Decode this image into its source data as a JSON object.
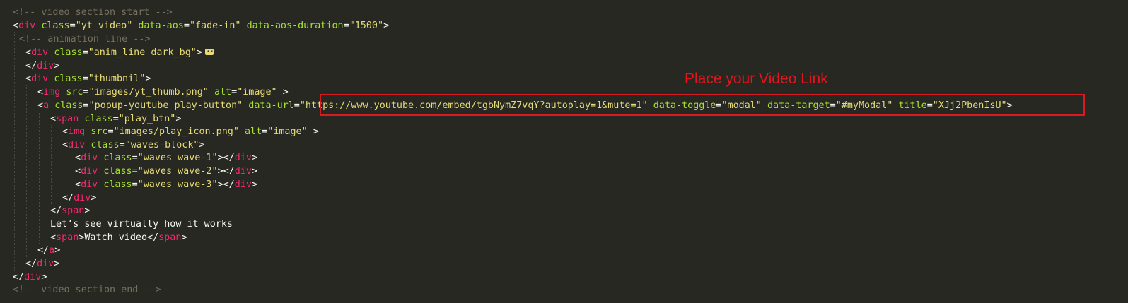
{
  "annotation": {
    "text": "Place your Video Link",
    "color": "#e7141d",
    "box_color": "#d81a23"
  },
  "theme": {
    "background": "#272822",
    "comment": "#75715e",
    "tag": "#f92672",
    "attribute": "#a6e22e",
    "string": "#e6db74",
    "text": "#f8f8f2"
  },
  "code": {
    "l1": {
      "c": "<!-- video section start -->"
    },
    "l2": {
      "o": "<",
      "t": "div",
      "a1": "class",
      "s1": "\"yt_video\"",
      "a2": "data-aos",
      "s2": "\"fade-in\"",
      "a3": "data-aos-duration",
      "s3": "\"1500\"",
      "e": ">"
    },
    "l3": {
      "c": "<!-- animation line -->"
    },
    "l4": {
      "o": "<",
      "t": "div",
      "a1": "class",
      "s1": "\"anim_line dark_bg\"",
      "e": ">"
    },
    "l5": {
      "o": "</",
      "t": "div",
      "e": ">"
    },
    "l6": {
      "o": "<",
      "t": "div",
      "a1": "class",
      "s1": "\"thumbnil\"",
      "e": ">"
    },
    "l7": {
      "o": "<",
      "t": "img",
      "a1": "src",
      "s1": "\"images/yt_thumb.png\"",
      "a2": "alt",
      "s2": "\"image\"",
      "e": " >"
    },
    "l8": {
      "o": "<",
      "t": "a",
      "a1": "class",
      "s1": "\"popup-youtube play-button\"",
      "a2": "data-url",
      "s2": "\"https://www.youtube.com/embed/tgbNymZ7vqY?autoplay=1&mute=1\"",
      "a3": "data-toggle",
      "s3": "\"modal\"",
      "a4": "data-target",
      "s4": "\"#myModal\"",
      "a5": "title",
      "s5": "\"XJj2PbenIsU\"",
      "e": ">"
    },
    "l9": {
      "o": "<",
      "t": "span",
      "a1": "class",
      "s1": "\"play_btn\"",
      "e": ">"
    },
    "l10": {
      "o": "<",
      "t": "img",
      "a1": "src",
      "s1": "\"images/play_icon.png\"",
      "a2": "alt",
      "s2": "\"image\"",
      "e": " >"
    },
    "l11": {
      "o": "<",
      "t": "div",
      "a1": "class",
      "s1": "\"waves-block\"",
      "e": ">"
    },
    "l12": {
      "o": "<",
      "t": "div",
      "a1": "class",
      "s1": "\"waves wave-1\"",
      "m": "></",
      "t2": "div",
      "e": ">"
    },
    "l13": {
      "o": "<",
      "t": "div",
      "a1": "class",
      "s1": "\"waves wave-2\"",
      "m": "></",
      "t2": "div",
      "e": ">"
    },
    "l14": {
      "o": "<",
      "t": "div",
      "a1": "class",
      "s1": "\"waves wave-3\"",
      "m": "></",
      "t2": "div",
      "e": ">"
    },
    "l15": {
      "o": "</",
      "t": "div",
      "e": ">"
    },
    "l16": {
      "o": "</",
      "t": "span",
      "e": ">"
    },
    "l17": {
      "text": "Let’s see virtually how it works"
    },
    "l18": {
      "o": "<",
      "t": "span",
      "m": ">",
      "text": "Watch video",
      "o2": "</",
      "t2": "span",
      "e": ">"
    },
    "l19": {
      "o": "</",
      "t": "a",
      "e": ">"
    },
    "l20": {
      "o": "</",
      "t": "div",
      "e": ">"
    },
    "l21": {
      "o": "</",
      "t": "div",
      "e": ">"
    },
    "l22": {
      "c": "<!-- video section end -->"
    }
  }
}
